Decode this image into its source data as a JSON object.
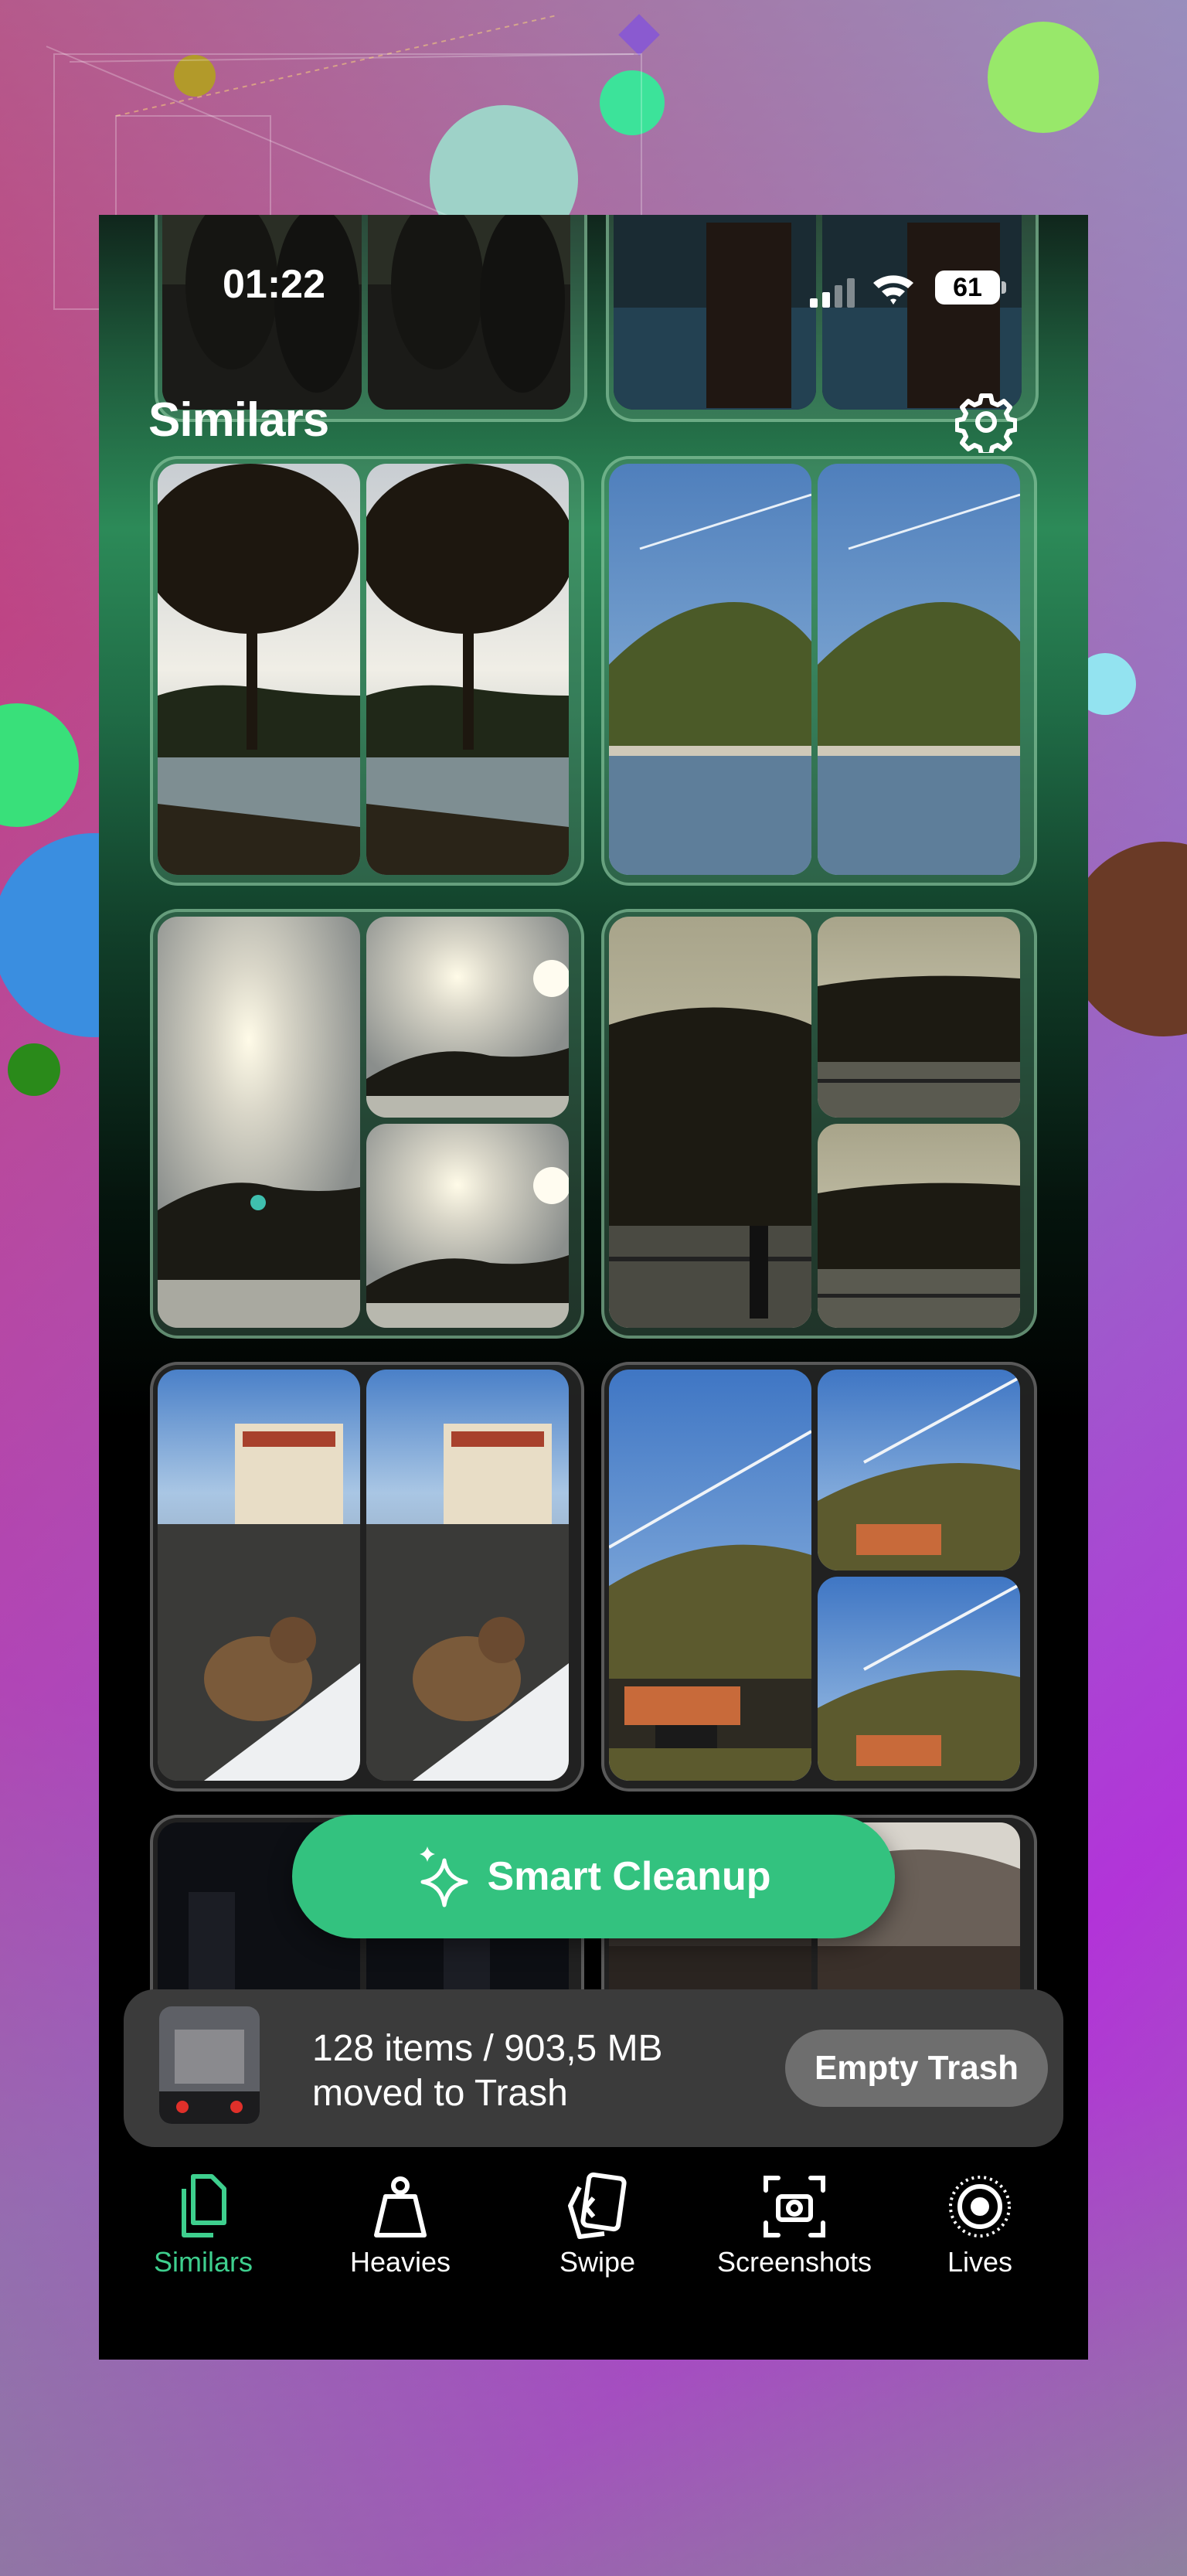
{
  "status_bar": {
    "time": "01:22",
    "battery": "61"
  },
  "header": {
    "title": "Similars"
  },
  "actions": {
    "smart_cleanup": "Smart Cleanup"
  },
  "trash": {
    "line1": "128 items / 903,5 MB",
    "line2": "moved to Trash",
    "button": "Empty Trash"
  },
  "tabs": [
    {
      "label": "Similars",
      "icon": "similars-icon",
      "active": true
    },
    {
      "label": "Heavies",
      "icon": "weight-icon",
      "active": false
    },
    {
      "label": "Swipe",
      "icon": "swipe-cards-icon",
      "active": false
    },
    {
      "label": "Screenshots",
      "icon": "screenshot-icon",
      "active": false
    },
    {
      "label": "Lives",
      "icon": "live-photo-icon",
      "active": false
    }
  ],
  "colors": {
    "accent": "#33c27f",
    "active_tab": "#3ecf8e",
    "trash_bar": "#3b3b3b"
  }
}
